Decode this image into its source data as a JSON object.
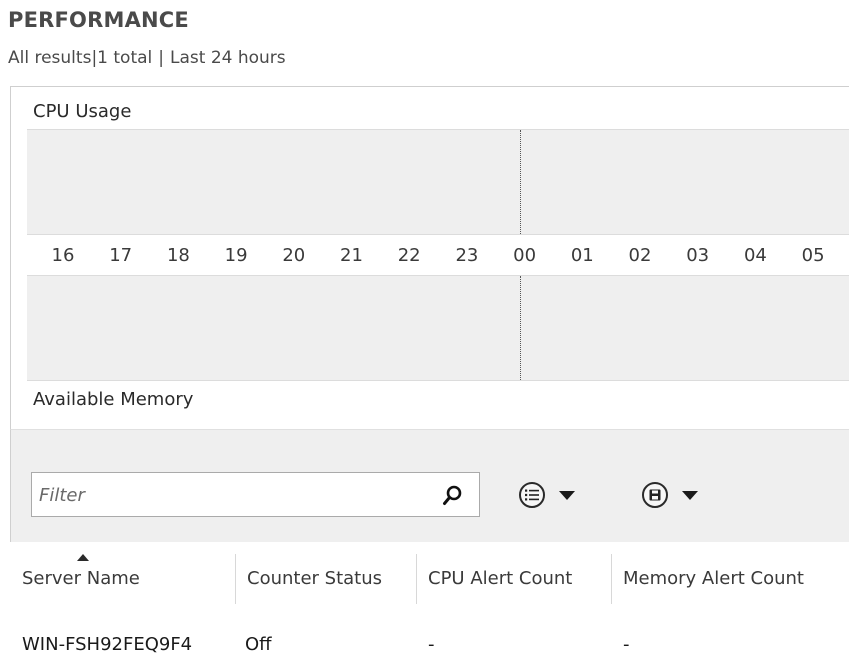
{
  "header": {
    "title": "PERFORMANCE",
    "scope": "All results",
    "count": "1 total",
    "period": "Last 24 hours",
    "sep1": "|",
    "sep2": "|"
  },
  "charts": {
    "cpu_label": "CPU Usage",
    "memory_label": "Available Memory",
    "time_ticks": [
      "16",
      "17",
      "18",
      "19",
      "20",
      "21",
      "22",
      "23",
      "00",
      "01",
      "02",
      "03",
      "04",
      "05"
    ]
  },
  "toolbar": {
    "filter_placeholder": "Filter",
    "search_icon": "search-icon",
    "list_icon": "list-options-icon",
    "save_icon": "save-icon"
  },
  "table": {
    "columns": [
      "Server Name",
      "Counter Status",
      "CPU Alert Count",
      "Memory Alert Count"
    ],
    "sorted_column": "Server Name",
    "rows": [
      [
        "WIN-FSH92FEQ9F4",
        "Off",
        "-",
        "-"
      ]
    ]
  }
}
